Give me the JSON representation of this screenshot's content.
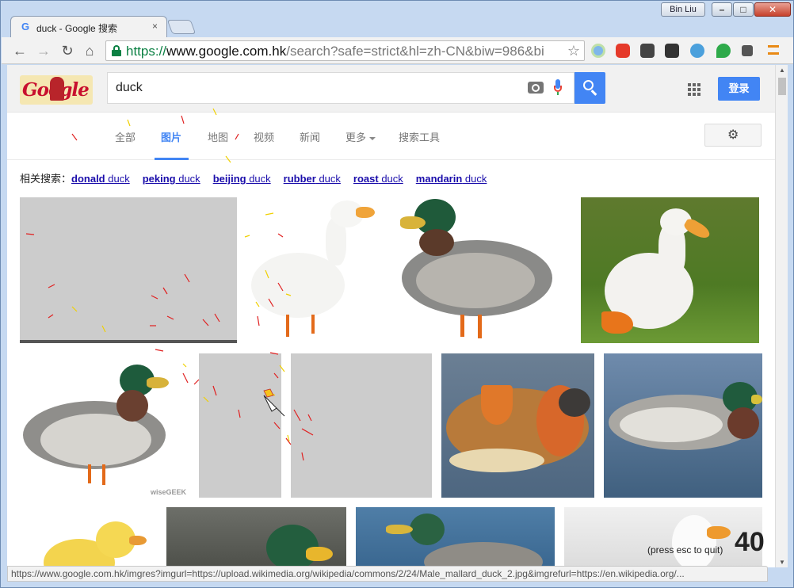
{
  "window": {
    "profile_name": "Bin Liu",
    "min_glyph": "–",
    "max_glyph": "□",
    "close_glyph": "✕"
  },
  "tab": {
    "favicon": "G",
    "title": "duck - Google 搜索",
    "close": "×"
  },
  "toolbar": {
    "back": "←",
    "forward": "→",
    "reload": "↻",
    "home": "⌂",
    "url_scheme": "https://",
    "url_host": "www.google.com.hk",
    "url_rest": "/search?safe=strict&hl=zh-CN&biw=986&bi",
    "star": "☆",
    "ext_icons": [
      "chrome-sync-icon",
      "adblock-icon",
      "pocket-icon",
      "evernote-icon",
      "vimium-icon",
      "leaf-icon",
      "puzzle-icon",
      "menu-icon"
    ]
  },
  "search": {
    "logo_text": "Google",
    "query": "duck",
    "signin": "登录"
  },
  "nav": {
    "tabs": [
      "全部",
      "图片",
      "地图",
      "视频",
      "新闻",
      "更多",
      "搜索工具"
    ],
    "active": "图片",
    "settings": "⚙"
  },
  "related": {
    "label": "相关搜索：",
    "items": [
      {
        "bold": "donald",
        "rest": " duck"
      },
      {
        "bold": "peking",
        "rest": " duck"
      },
      {
        "bold": "beijing",
        "rest": " duck"
      },
      {
        "bold": "rubber",
        "rest": " duck"
      },
      {
        "bold": "roast",
        "rest": " duck"
      },
      {
        "bold": "mandarin",
        "rest": " duck"
      }
    ]
  },
  "thumbs": {
    "credit": "wiseGEEK"
  },
  "overlay": {
    "quit_text": "(press esc to quit)",
    "counter": "40"
  },
  "status_url": "https://www.google.com.hk/imgres?imgurl=https://upload.wikimedia.org/wikipedia/commons/2/24/Male_mallard_duck_2.jpg&imgrefurl=https://en.wikipedia.org/..."
}
